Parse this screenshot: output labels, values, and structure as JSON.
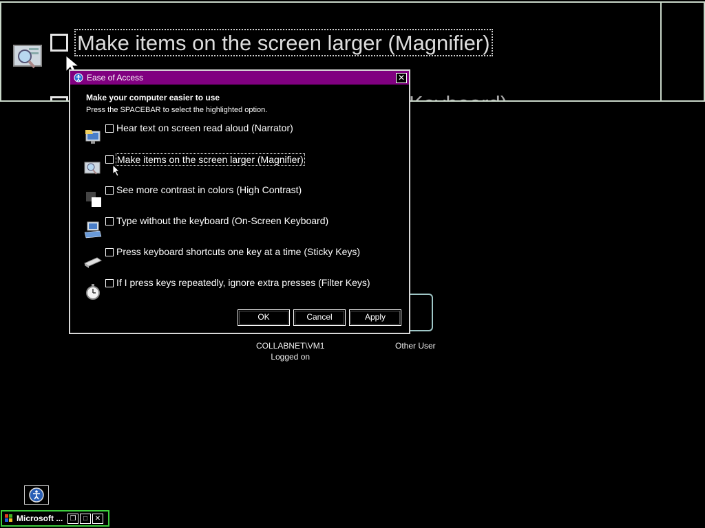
{
  "magnifier": {
    "option_label": "Make items on the screen larger (Magnifier)",
    "cutoff_text": "Keyboard)"
  },
  "dialog": {
    "title": "Ease of Access",
    "close_glyph": "✕",
    "heading": "Make your computer easier to use",
    "subheading": "Press the SPACEBAR to select the highlighted option.",
    "options": [
      {
        "label": "Hear text on screen read aloud (Narrator)",
        "icon": "narrator-icon",
        "checked": false
      },
      {
        "label": "Make items on the screen larger (Magnifier)",
        "icon": "magnifier-icon",
        "checked": false
      },
      {
        "label": "See more contrast in colors (High Contrast)",
        "icon": "high-contrast-icon",
        "checked": false
      },
      {
        "label": "Type without the keyboard (On-Screen Keyboard)",
        "icon": "keyboard-icon",
        "checked": false
      },
      {
        "label": "Press keyboard shortcuts one key at a time (Sticky Keys)",
        "icon": "sticky-keys-icon",
        "checked": false
      },
      {
        "label": "If I press keys repeatedly, ignore extra presses (Filter Keys)",
        "icon": "filter-keys-icon",
        "checked": false
      }
    ],
    "buttons": {
      "ok": "OK",
      "cancel": "Cancel",
      "apply": "Apply"
    }
  },
  "login": {
    "user1_line1": "COLLABNET\\VM1",
    "user1_line2": "Logged on",
    "user2": "Other User"
  },
  "taskbar": {
    "item_label": "Microsoft ...",
    "restore_glyph": "❐",
    "maximize_glyph": "□",
    "close_glyph": "✕"
  },
  "colors": {
    "titlebar": "#800080",
    "taskbar_border": "#3ecf3e",
    "background": "#000000"
  }
}
